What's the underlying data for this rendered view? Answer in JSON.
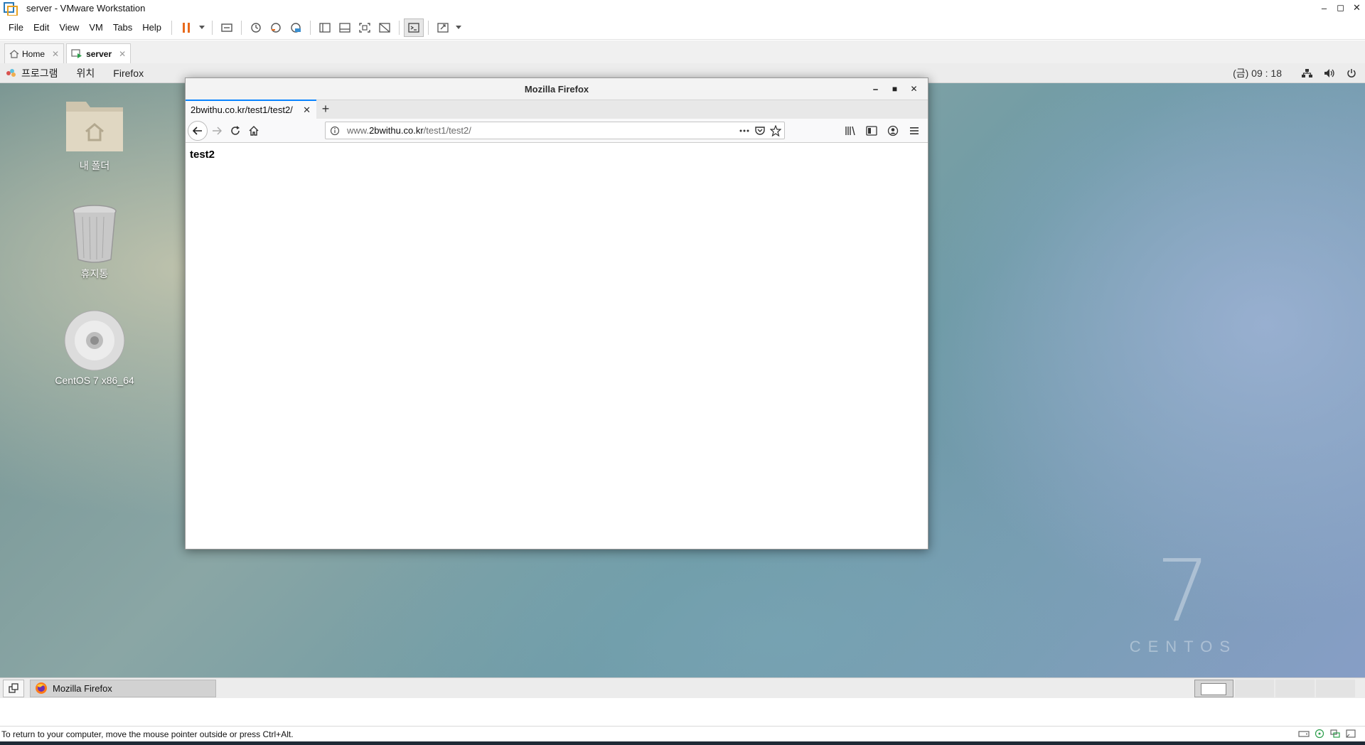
{
  "vmware": {
    "title": "server - VMware Workstation",
    "menu": [
      "File",
      "Edit",
      "View",
      "VM",
      "Tabs",
      "Help"
    ],
    "tabs": [
      {
        "label": "Home",
        "active": false
      },
      {
        "label": "server",
        "active": true
      }
    ],
    "status_text": "To return to your computer, move the mouse pointer outside or press Ctrl+Alt."
  },
  "gnome": {
    "top_menu": [
      "프로그램",
      "위치",
      "Firefox"
    ],
    "clock": "(금) 09 : 18",
    "desktop_icons": [
      {
        "label": "내 폴더",
        "icon": "home-folder-icon"
      },
      {
        "label": "휴지통",
        "icon": "trash-icon"
      },
      {
        "label": "CentOS 7 x86_64",
        "icon": "disc-icon"
      }
    ],
    "taskbar_item": "Mozilla Firefox",
    "branding": {
      "number": "7",
      "word": "CENTOS"
    }
  },
  "firefox": {
    "window_title": "Mozilla Firefox",
    "tab_title": "2bwithu.co.kr/test1/test2/",
    "url_prefix": "www.",
    "url_host": "2bwithu.co.kr",
    "url_path": "/test1/test2/",
    "page_heading": "test2"
  }
}
